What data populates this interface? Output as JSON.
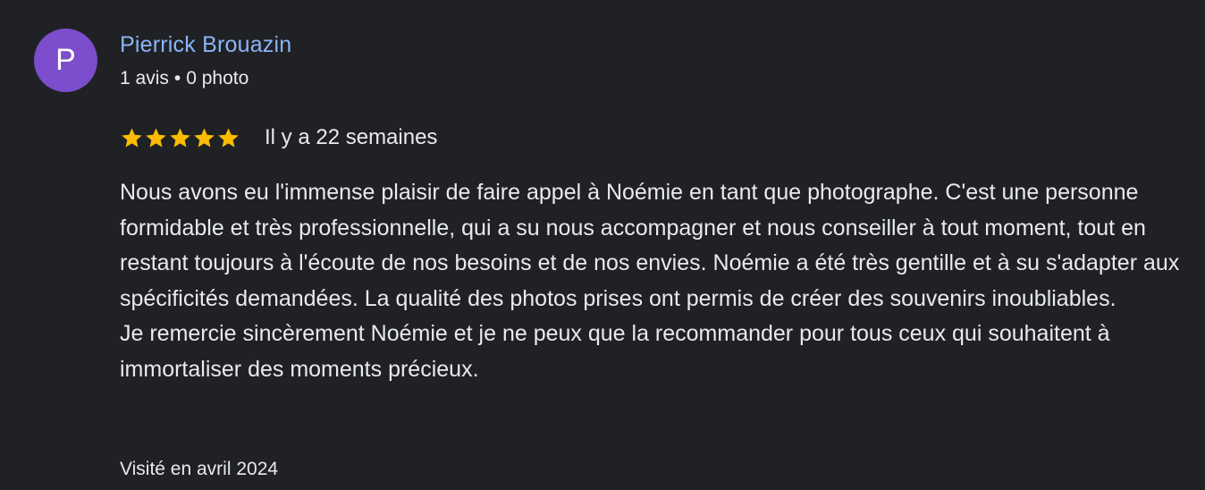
{
  "reviewer": {
    "initial": "P",
    "avatar_color": "#7c4dcc",
    "name": "Pierrick Brouazin",
    "reviews_count": "1 avis",
    "separator": "•",
    "photos_count": "0 photo"
  },
  "rating": {
    "stars": 5,
    "max_stars": 5,
    "star_color": "#fbbc04",
    "time_ago": "Il y a 22 semaines"
  },
  "review": {
    "paragraph_1": "Nous avons eu l'immense plaisir de faire appel à Noémie en tant que photographe. C'est une personne formidable et très professionnelle, qui a su nous accompagner et nous conseiller à tout moment, tout en restant toujours à l'écoute de nos besoins et de nos envies. Noémie a été très gentille et à su s'adapter aux spécificités demandées. La qualité des photos prises ont permis de créer des souvenirs inoubliables.",
    "paragraph_2": "Je remercie sincèrement Noémie et je ne peux que la recommander pour tous ceux qui souhaitent à immortaliser des moments précieux."
  },
  "visit": {
    "text": "Visité en avril 2024"
  },
  "colors": {
    "background": "#202124",
    "name_link": "#8ab4f8",
    "text": "#e8eaed"
  }
}
